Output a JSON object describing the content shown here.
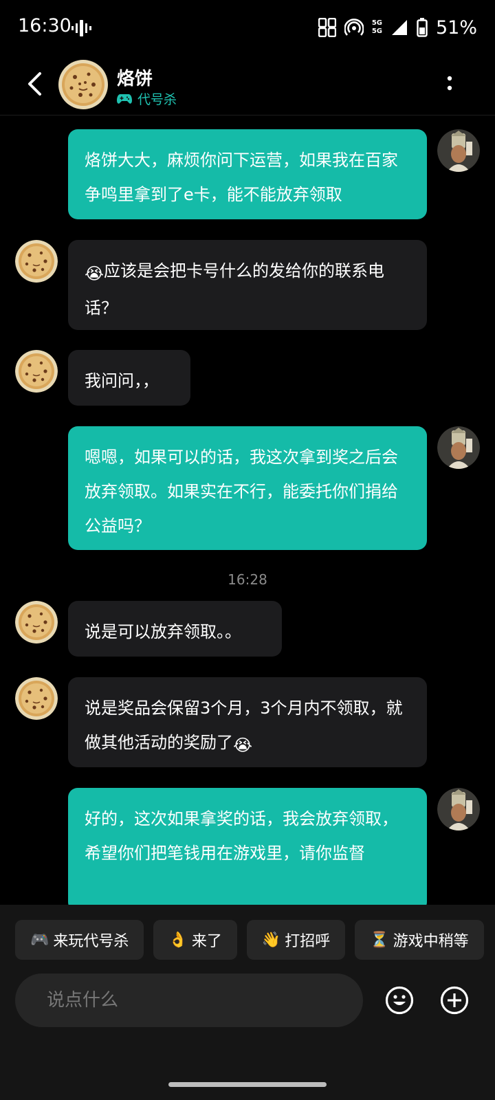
{
  "status_bar": {
    "time": "16:30",
    "network_label_1": "5G",
    "network_label_2": "5G",
    "battery": "51%"
  },
  "header": {
    "contact_name": "烙饼",
    "game_tag": "代号杀"
  },
  "chat": {
    "messages": [
      {
        "direction": "out",
        "text": "烙饼大大，麻烦你问下运营，如果我在百家争鸣里拿到了e卡，能不能放弃领取"
      },
      {
        "direction": "in",
        "emoji": "😭",
        "text": "应该是会把卡号什么的发给你的联系电话？"
      },
      {
        "direction": "in",
        "text": "我问问，，"
      },
      {
        "direction": "out",
        "text": "嗯嗯，如果可以的话，我这次拿到奖之后会放弃领取。如果实在不行，能委托你们捐给公益吗？"
      },
      {
        "direction": "in",
        "text": "说是可以放弃领取。。"
      },
      {
        "direction": "in",
        "text": "说是奖品会保留3个月，3个月内不领取，就做其他活动的奖励了",
        "emoji": "😭"
      },
      {
        "direction": "out",
        "text": "好的，这次如果拿奖的话，我会放弃领取，希望你们把笔钱用在游戏里，请你监督"
      }
    ],
    "timestamp": "16:28"
  },
  "quick_replies": [
    {
      "icon": "🎮",
      "label": "来玩代号杀"
    },
    {
      "icon": "👌",
      "label": "来了"
    },
    {
      "icon": "👋",
      "label": "打招呼"
    },
    {
      "icon": "⏳",
      "label": "游戏中稍等"
    }
  ],
  "input": {
    "placeholder": "说点什么"
  },
  "colors": {
    "accent": "#15bba8",
    "incoming_bubble": "#1c1c1e",
    "background": "#000000"
  }
}
